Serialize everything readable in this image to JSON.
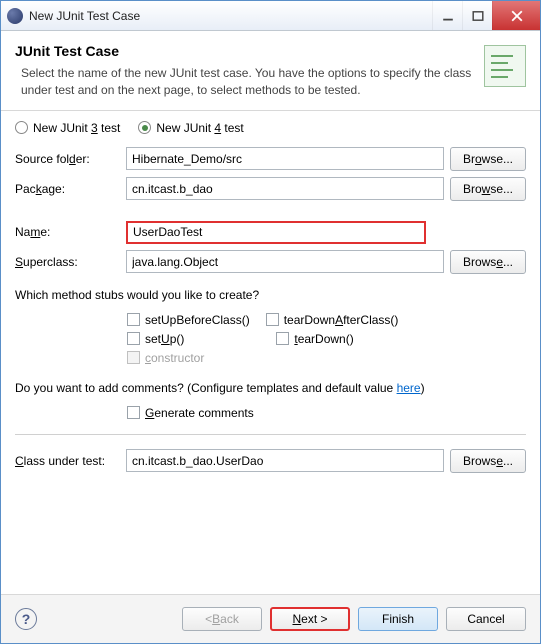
{
  "window": {
    "title": "New JUnit Test Case"
  },
  "header": {
    "title": "JUnit Test Case",
    "desc": "Select the name of the new JUnit test case. You have the options to specify the class under test and on the next page, to select methods to be tested."
  },
  "radios": {
    "junit3": "New JUnit 3 test",
    "junit4": "New JUnit 4 test"
  },
  "labels": {
    "source_folder": "Source folder:",
    "package": "Package:",
    "name": "Name:",
    "superclass": "Superclass:",
    "class_under_test": "Class under test:",
    "browse": "Browse...",
    "browse_disabled": "Browse..."
  },
  "values": {
    "source_folder": "Hibernate_Demo/src",
    "package": "cn.itcast.b_dao",
    "name": "UserDaoTest",
    "superclass": "java.lang.Object",
    "class_under_test": "cn.itcast.b_dao.UserDao"
  },
  "stubs": {
    "question": "Which method stubs would you like to create?",
    "setUpBeforeClass": "setUpBeforeClass()",
    "tearDownAfterClass": "tearDownAfterClass()",
    "setUp": "setUp()",
    "tearDown": "tearDown()",
    "constructor": "constructor"
  },
  "comments": {
    "question_a": "Do you want to add comments? (Configure templates and default value ",
    "link": "here",
    "question_b": ")",
    "generate": "Generate comments"
  },
  "footer": {
    "back": "< Back",
    "next": "Next >",
    "finish": "Finish",
    "cancel": "Cancel",
    "help": "?"
  }
}
